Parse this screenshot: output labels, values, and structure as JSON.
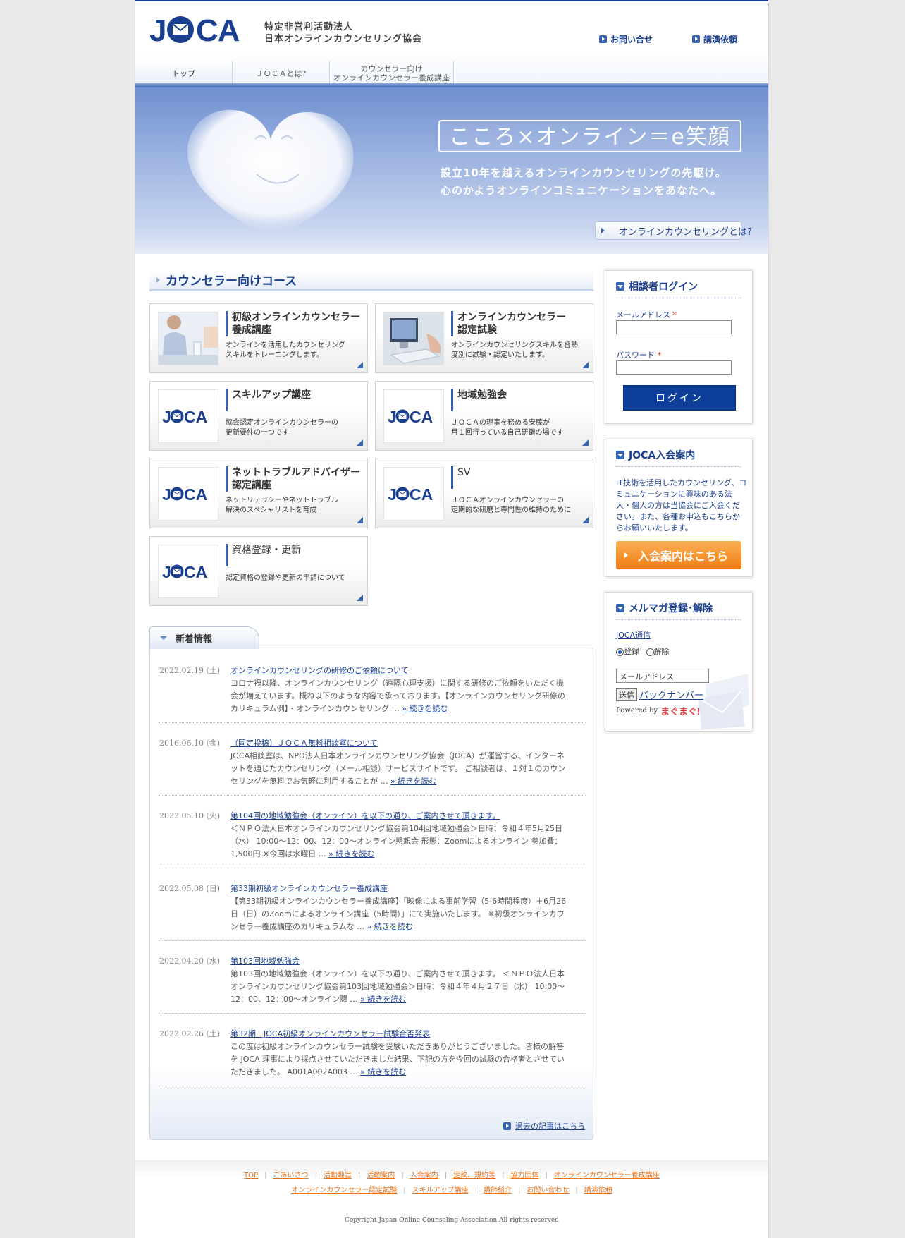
{
  "header": {
    "logo_text": "JOCA",
    "org_line1": "特定非営利活動法人",
    "org_line2": "日本オンラインカウンセリング協会",
    "contact_link": "お問い合せ",
    "lecture_link": "講演依頼"
  },
  "nav": {
    "tabs": [
      {
        "label": "トップ"
      },
      {
        "label": "ＪＯＣＡとは?"
      },
      {
        "label_line1": "カウンセラー向け",
        "label_line2": "オンラインカウンセラー養成講座"
      }
    ]
  },
  "hero": {
    "tagline": "こころ×オンライン＝e笑顔",
    "sub1": "設立10年を越えるオンラインカウンセリングの先駆け。",
    "sub2": "心のかようオンラインコミュニケーションをあなたへ。",
    "button": "オンラインカウンセリングとは?"
  },
  "courses": {
    "title": "カウンセラー向けコース",
    "cards": [
      {
        "title1": "初級オンラインカウンセラー",
        "title2": "養成講座",
        "desc1": "オンラインを活用したカウンセリング",
        "desc2": "スキルをトレーニングします。"
      },
      {
        "title1": "オンラインカウンセラー",
        "title2": "認定試験",
        "desc1": "オンラインカウンセリングスキルを習熟",
        "desc2": "度別に試験・認定いたします。"
      },
      {
        "title1": "スキルアップ講座",
        "title2": "",
        "desc1": "協会認定オンラインカウンセラーの",
        "desc2": "更新要件の一つです"
      },
      {
        "title1": "地域勉強会",
        "title2": "",
        "desc1": "ＪＯＣＡの理事を務める安藤が",
        "desc2": "月１回行っている自己研鑽の場です"
      },
      {
        "title1": "ネットトラブルアドバイザー",
        "title2": "認定講座",
        "desc1": "ネットリテラシーやネットトラブル",
        "desc2": "解決のスペシャリストを育成"
      },
      {
        "title1": "SV",
        "title2": "",
        "desc1": "ＪＯＣＡオンラインカウンセラーの",
        "desc2": "定期的な研磨と専門性の維持のために"
      },
      {
        "title1": "資格登録・更新",
        "title2": "",
        "desc1": "認定資格の登録や更新の申請について",
        "desc2": ""
      }
    ]
  },
  "news": {
    "tab_label": "新着情報",
    "more_label": "» 続きを読む",
    "archive_link": "過去の記事はこちら",
    "items": [
      {
        "date": "2022.02.19 (土)",
        "title": "オンラインカウンセリングの研修のご依頼について",
        "body": "コロナ禍以降、オンラインカウンセリング（遠隔心理支援）に関する研修のご依頼をいただく機会が増えています。概ね以下のような内容で承っております。【オンラインカウンセリング研修のカリキュラム例】・オンラインカウンセリング …"
      },
      {
        "date": "2016.06.10 (金)",
        "title": "（固定投稿）ＪＯＣＡ無料相談室について",
        "body": "JOCA相談室は、NPO法人日本オンラインカウンセリング協会（JOCA）が運営する、インターネットを通じたカウンセリング（メール相談）サービスサイトです。 ご相談者は、１対１のカウンセリングを無料でお気軽に利用することが …"
      },
      {
        "date": "2022.05.10 (火)",
        "title": "第104回の地域勉強会（オンライン）を以下の通り、ご案内させて頂きます。",
        "body": "＜ＮＰＯ法人日本オンラインカウンセリング協会第104回地域勉強会＞日時：令和４年5月25日（水） 10:00〜12：00、12：00～オンライン懇親会 形態：Zoomによるオンライン 参加費：1,500円 ※今回は水曜日 …"
      },
      {
        "date": "2022.05.08 (日)",
        "title": "第33期初級オンラインカウンセラー養成講座",
        "body": "【第33期初級オンラインカウンセラー養成講座】「映像による事前学習（5-6時間程度）＋6月26日（日）のZoomによるオンライン講座（5時間）」にて実施いたします。 ※初級オンラインカウンセラー養成講座のカリキュラムな …"
      },
      {
        "date": "2022.04.20 (水)",
        "title": "第103回地域勉強会",
        "body": "第103回の地域勉強会（オンライン）を以下の通り、ご案内させて頂きます。 ＜ＮＰＯ法人日本オンラインカウンセリング協会第103回地域勉強会＞日時：令和４年４月２７日（水） 10:00〜12：00、12：00～オンライン懇 …"
      },
      {
        "date": "2022.02.26 (土)",
        "title": "第32期　JOCA初級オンラインカウンセラー試験合否発表",
        "body": "この度は初級オンラインカウンセラー試験を受験いただきありがとうございました。皆様の解答を JOCA 理事により採点させていただきました結果、下記の方を今回の試験の合格者とさせていただきました。 A001A002A003 …"
      }
    ]
  },
  "sidebar": {
    "login": {
      "title": "相談者ログイン",
      "email_label": "メールアドレス",
      "password_label": "パスワード",
      "required_mark": "*",
      "button": "ログイン"
    },
    "join": {
      "title": "JOCA入会案内",
      "body": "IT技術を活用したカウンセリング、コミュニケーションに興味のある法人・個人の方は当協会にご入会ください。また、各種お申込もこちらからお願いいたします。",
      "button": "入会案内はこちら"
    },
    "mailmag": {
      "title": "メルマガ登録･解除",
      "link": "JOCA通信",
      "radio_register": "登録",
      "radio_cancel": "解除",
      "email_value": "メールアドレス",
      "send_button": "送信",
      "backnumber": "バックナンバー",
      "powered_by": "Powered by",
      "powered_brand": "まぐまぐ!"
    }
  },
  "footer": {
    "row1": [
      "TOP",
      "ごあいさつ",
      "活動趣旨",
      "活動案内",
      "入会案内",
      "定款、規約等",
      "協力団体",
      "オンラインカウンセラー養成講座"
    ],
    "row2": [
      "オンラインカウンセラー認定試験",
      "スキルアップ講座",
      "講師紹介",
      "お問い合わせ",
      "講演依頼"
    ],
    "copyright": "Copyright Japan Online Counseling Association All rights reserved"
  },
  "colors": {
    "brand": "#1b3f8f",
    "accent_orange": "#f07c13",
    "link_orange": "#e8731a"
  }
}
